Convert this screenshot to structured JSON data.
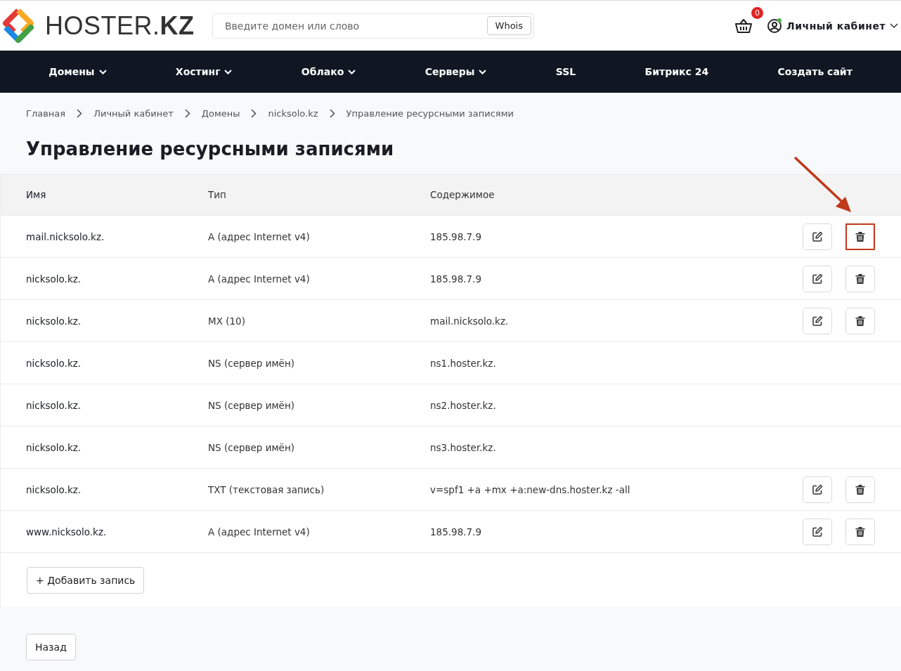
{
  "header": {
    "logo": "HOSTER.**KZ**",
    "search": {
      "placeholder": "Введите домен или слово",
      "button": "Whois"
    },
    "cart_count": "0",
    "account": "Личный кабинет"
  },
  "nav": [
    {
      "label": "Домены",
      "dropdown": true
    },
    {
      "label": "Хостинг",
      "dropdown": true
    },
    {
      "label": "Облако",
      "dropdown": true
    },
    {
      "label": "Серверы",
      "dropdown": true
    },
    {
      "label": "SSL",
      "dropdown": false
    },
    {
      "label": "Битрикс 24",
      "dropdown": false
    },
    {
      "label": "Создать сайт",
      "dropdown": false
    }
  ],
  "breadcrumbs": [
    "Главная",
    "Личный кабинет",
    "Домены",
    "nicksolo.kz",
    "Управление ресурсными записями"
  ],
  "title": "Управление ресурсными записями",
  "table": {
    "columns": [
      "Имя",
      "Тип",
      "Содержимое"
    ],
    "rows": [
      {
        "name": "mail.nicksolo.kz.",
        "type": "A (адрес Internet v4)",
        "content": "185.98.7.9",
        "editable": true,
        "highlighted": true
      },
      {
        "name": "nicksolo.kz.",
        "type": "A (адрес Internet v4)",
        "content": "185.98.7.9",
        "editable": true,
        "highlighted": false
      },
      {
        "name": "nicksolo.kz.",
        "type": "MX (10)",
        "content": "mail.nicksolo.kz.",
        "editable": true,
        "highlighted": false
      },
      {
        "name": "nicksolo.kz.",
        "type": "NS (сервер имён)",
        "content": "ns1.hoster.kz.",
        "editable": false
      },
      {
        "name": "nicksolo.kz.",
        "type": "NS (сервер имён)",
        "content": "ns2.hoster.kz.",
        "editable": false
      },
      {
        "name": "nicksolo.kz.",
        "type": "NS (сервер имён)",
        "content": "ns3.hoster.kz.",
        "editable": false
      },
      {
        "name": "nicksolo.kz.",
        "type": "TXT (текстовая запись)",
        "content": "v=spf1 +a +mx +a:new-dns.hoster.kz -all",
        "editable": true,
        "highlighted": false
      },
      {
        "name": "www.nicksolo.kz.",
        "type": "A (адрес Internet v4)",
        "content": "185.98.7.9",
        "editable": true,
        "highlighted": false
      }
    ]
  },
  "add_button": "+ Добавить запись",
  "back_button": "Назад"
}
